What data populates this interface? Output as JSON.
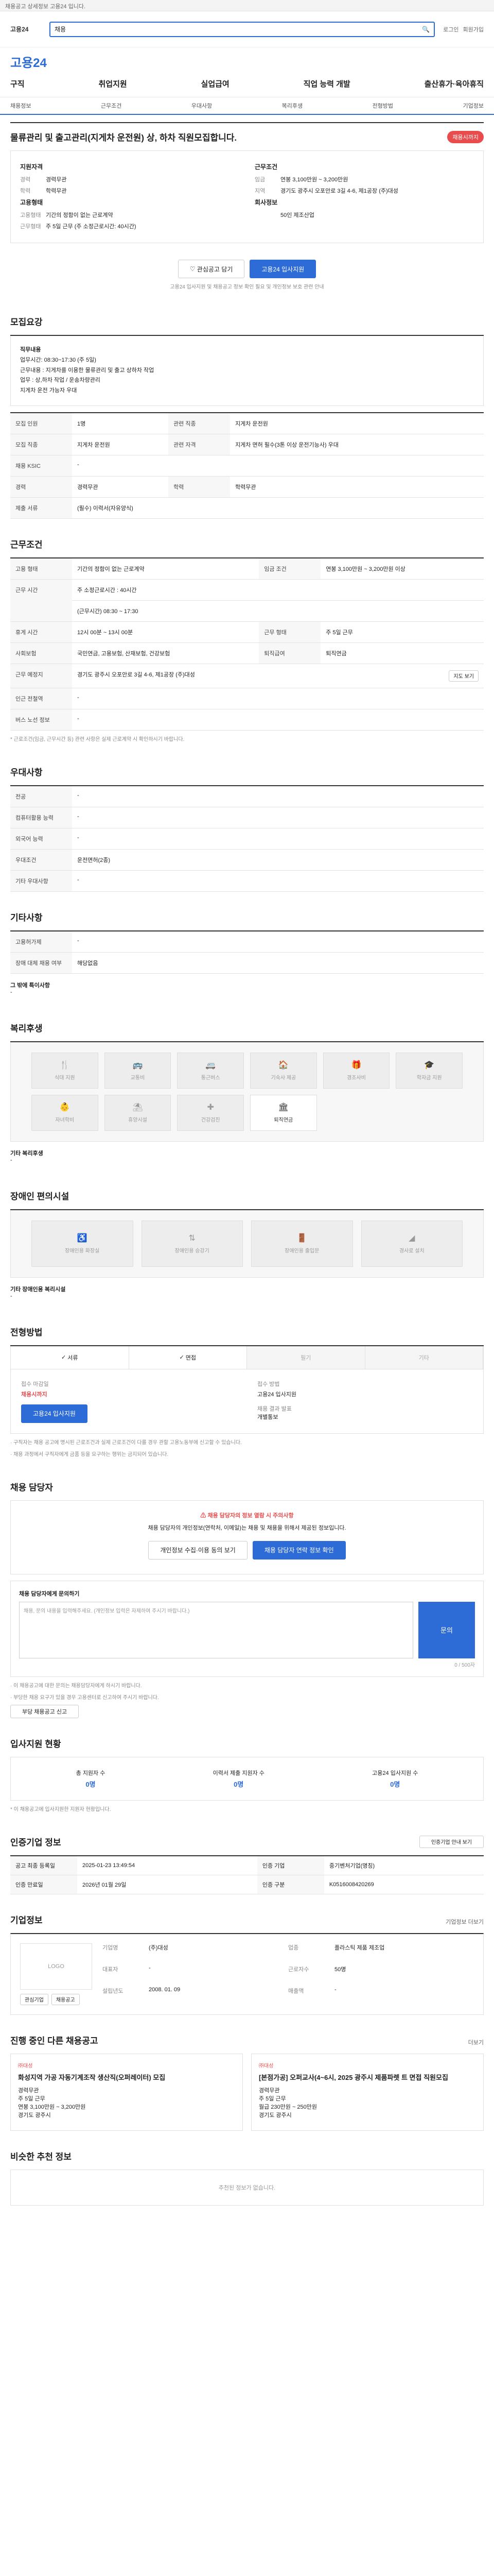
{
  "topbar": {
    "text": "채용공고 상세정보 고용24 입니다."
  },
  "header": {
    "logo": "고용24",
    "search_placeholder": "채용",
    "right_links": [
      "로그인",
      "회원가입"
    ]
  },
  "brand": {
    "name": "고용24"
  },
  "mainnav": [
    "구직",
    "취업지원",
    "실업급여",
    "직업 능력 개발",
    "출산휴가·육아휴직"
  ],
  "subnav": [
    "채용정보",
    "근무조건",
    "우대사항",
    "복리후생",
    "전형방법",
    "기업정보"
  ],
  "post": {
    "title": "물류관리 및 출고관리(지게차 운전원) 상, 하차 직원모집합니다.",
    "badge": "채용시까지",
    "left_heading": "지원자격",
    "left": [
      {
        "k": "경력",
        "v": "경력무관"
      },
      {
        "k": "학력",
        "v": "학력무관"
      }
    ],
    "left_heading2": "고용형태",
    "left2": [
      {
        "k": "고용형태",
        "v": "기간의 정함이 없는 근로계약"
      },
      {
        "k": "근무형태",
        "v": "주 5일 근무 (주 소정근로시간: 40시간)"
      }
    ],
    "right_heading": "근무조건",
    "right": [
      {
        "k": "임금",
        "v": "연봉 3,100만원 ~ 3,200만원"
      },
      {
        "k": "지역",
        "v": "경기도 광주시 오포안로 3길 4-6, 제1공장 (주)대성"
      }
    ],
    "right_heading2": "회사정보",
    "right2": [
      {
        "k": "",
        "v": "50인 제조산업"
      }
    ],
    "btn_save": "관심공고 담기",
    "btn_apply": "고용24 입사지원",
    "note": "고용24 입사지원 및 채용공고 정보 확인 필요 및 개인정보 보호 관련 안내"
  },
  "sections": {
    "recruit": "모집요강",
    "conditions": "근무조건",
    "preference": "우대사항",
    "other": "기타사항",
    "benefits": "복리후생",
    "disability": "장애인 편의시설",
    "process": "전형방법",
    "contact": "채용 담당자",
    "applicants": "입사지원 현황",
    "certification": "인증기업 정보",
    "company": "기업정보",
    "other_jobs": "진행 중인 다른 채용공고",
    "recommend": "비슷한 추천 정보"
  },
  "recruit": {
    "duty_heading": "직무내용",
    "duties": [
      "업무시간: 08:30~17:30 (주 5일)",
      "근무내용 : 지게차를 이용한 물류관리 및 출고 상하차 작업",
      "업무 : 상,하차 작업 / 운송차량관리",
      "지게차 운전 가능자 우대"
    ],
    "rows": [
      {
        "k": "모집 인원",
        "v": "1명",
        "k2": "관련 직종",
        "v2": "지게차 운전원"
      },
      {
        "k": "모집 직종",
        "v": "지게차 운전원",
        "k2": "관련 자격",
        "v2": "지게차 면허 필수(3톤 이상 운전기능사) 우대"
      },
      {
        "k": "채용 KSIC",
        "v": "-",
        "k2": "",
        "v2": ""
      },
      {
        "k": "경력",
        "v": "경력무관",
        "k2": "학력",
        "v2": "학력무관"
      },
      {
        "k": "제출 서류",
        "v": "(필수) 이력서(자유양식)",
        "k2": "",
        "v2": ""
      }
    ]
  },
  "conditions": {
    "rows": [
      {
        "k": "고용 형태",
        "v": "기간의 정함이 없는 근로계약",
        "k2": "임금 조건",
        "v2": "연봉 3,100만원 ~ 3,200만원 이상"
      },
      {
        "k": "근무 시간",
        "v": "주 소정근로시간 : 40시간",
        "k2": "",
        "v2": ""
      },
      {
        "k": "",
        "v": "(근무시간) 08:30 ~ 17:30",
        "k2": "",
        "v2": ""
      },
      {
        "k": "휴게 시간",
        "v": "12시 00분 ~ 13시 00분",
        "k2": "근무 형태",
        "v2": "주 5일 근무"
      },
      {
        "k": "사회보험",
        "v": "국민연금, 고용보험, 산재보험, 건강보험",
        "k2": "퇴직급여",
        "v2": "퇴직연금"
      },
      {
        "k": "근무 예정지",
        "v": "경기도 광주시 오포안로 3길 4-6, 제1공장 (주)대성",
        "k2": "",
        "v2": ""
      },
      {
        "k": "인근 전철역",
        "v": "-",
        "k2": "",
        "v2": ""
      },
      {
        "k": "버스 노선 정보",
        "v": "-",
        "k2": "",
        "v2": ""
      }
    ],
    "map_button": "지도 보기",
    "footnote": "* 근로조건(임금, 근무시간 등) 관련 사항은 실제 근로계약 시 확인하시기 바랍니다."
  },
  "preference": {
    "rows": [
      {
        "k": "전공",
        "v": "-"
      },
      {
        "k": "컴퓨터활용 능력",
        "v": "-"
      },
      {
        "k": "외국어 능력",
        "v": "-"
      },
      {
        "k": "우대조건",
        "v": "운전면허(2종)"
      },
      {
        "k": "기타 우대사항",
        "v": "-"
      }
    ]
  },
  "other": {
    "rows": [
      {
        "k": "고용허가제",
        "v": "-"
      },
      {
        "k": "장애 대체 채용 여부",
        "v": "해당없음"
      }
    ],
    "extra_label": "그 밖에 특이사항",
    "extra_value": "-"
  },
  "benefits": {
    "items": [
      "식대 지원",
      "교통비",
      "통근버스",
      "기숙사 제공",
      "경조사비",
      "학자금 지원",
      "자녀학비",
      "휴양시설",
      "건강검진",
      "퇴직연금"
    ],
    "active_index": 9,
    "more_label": "기타 복리후생",
    "more_value": "-"
  },
  "disability": {
    "items": [
      "장애인용 화장실",
      "장애인용 승강기",
      "장애인용 출입문",
      "경사로 설치"
    ],
    "more_label": "기타 장애인용 복리시설",
    "more_value": "-"
  },
  "process": {
    "methods": [
      "서류",
      "면접",
      "필기",
      "기타"
    ],
    "method_on": [
      true,
      true,
      false,
      false
    ],
    "apply_label": "접수 마감일",
    "apply_value": "채용시까지",
    "apply_label2": "접수 방법",
    "apply_value2": "고용24 입사지원",
    "result_label": "채용 결과 발표",
    "result_value": "개별통보",
    "apply_btn": "고용24 입사지원",
    "notes": [
      "· 구직자는 채용 공고에 명시된 근로조건과 실제 근로조건이 다를 경우 관할 고용노동부에 신고할 수 있습니다.",
      "· 채용 과정에서 구직자에게 금품 등을 요구하는 행위는 금지되어 있습니다."
    ]
  },
  "contact": {
    "warn": "채용 담당자의 정보 열람 시 주의사항",
    "desc": "채용 담당자의 개인정보(연락처, 이메일)는 채용 및 채용을 위해서 제공된 정보입니다.",
    "btn_view": "개인정보 수집·이용 동의 보기",
    "btn_show": "채용 담당자 연락 정보 확인",
    "inquiry_label": "채용 담당자에게 문의하기",
    "inquiry_placeholder": "채용, 문의 내용을 입력해주세요. (개인정보 입력은 자제하여 주시기 바랍니다.)",
    "inquiry_btn": "문의",
    "inquiry_count": "0 / 500자",
    "bullets": [
      "· 이 채용공고에 대한 문의는 채용담당자에게 하시기 바랍니다.",
      "· 부당한 채용 요구가 있을 경우 고용센터로 신고하여 주시기 바랍니다."
    ],
    "report_btn": "부당 채용공고 신고"
  },
  "applicants": {
    "items": [
      {
        "label": "총 지원자 수",
        "n": "0명"
      },
      {
        "label": "이력서 제출 지원자 수",
        "n": "0명"
      },
      {
        "label": "고용24 입사지원 수",
        "n": "0명"
      }
    ],
    "note": "* 이 채용공고에 입사지원한 지원자 현황입니다."
  },
  "certification": {
    "rows": [
      {
        "k": "공고 최종 등록일",
        "v": "2025-01-23 13:49:54",
        "k2": "인증 기업",
        "v2": "중기벤처기업(명칭)"
      },
      {
        "k": "인증 만료일",
        "v": "2026년 01월 29일",
        "k2": "인증 구분",
        "v2": "K0516008420269"
      }
    ],
    "more_link": "인증기업 안내 보기"
  },
  "company": {
    "logo_text": "LOGO",
    "info": [
      {
        "k": "기업명",
        "v": "(주)대성"
      },
      {
        "k": "업종",
        "v": "플라스틱 제품 제조업"
      },
      {
        "k": "대표자",
        "v": "-"
      },
      {
        "k": "근로자수",
        "v": "50명"
      },
      {
        "k": "설립년도",
        "v": "2008. 01. 09"
      },
      {
        "k": "매출액",
        "v": "-"
      }
    ],
    "more": "기업정보 더보기",
    "btn_follow": "관심기업",
    "btn_list": "채용공고"
  },
  "other_jobs": {
    "more": "더보기",
    "cards": [
      {
        "co": "㈜대성",
        "title": "화성지역 가공 자동기계조작 생산직(오퍼레이터) 모집",
        "lines": [
          "경력무관",
          "주 5일 근무",
          "연봉 3,100만원 ~ 3,200만원",
          "경기도 광주시"
        ]
      },
      {
        "co": "㈜대성",
        "title": "[본점가공] 오퍼교사(4~6시, 2025 광주시 제품파렛 트 면접 직원모집",
        "lines": [
          "경력무관",
          "주 5일 근무",
          "월급 230만원 ~ 250만원",
          "경기도 광주시"
        ]
      }
    ]
  },
  "recommend": {
    "empty": "추천된 정보가 없습니다."
  }
}
